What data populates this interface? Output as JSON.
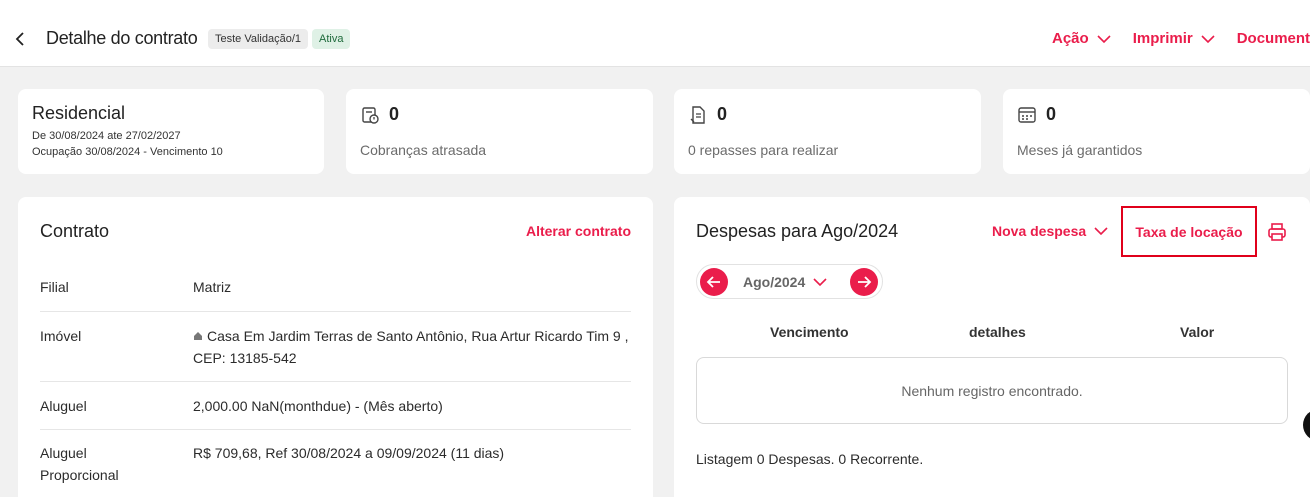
{
  "header": {
    "title": "Detalhe do contrato",
    "tag_ref": "Teste Validação/1",
    "tag_status": "Ativa",
    "actions": [
      "Ação",
      "Imprimir",
      "Documentos"
    ]
  },
  "summary": {
    "type": "Residencial",
    "period": "De 30/08/2024 ate 27/02/2027",
    "occupation": "Ocupação 30/08/2024 - Vencimento 10"
  },
  "stats": [
    {
      "value": "0",
      "label": "Cobranças atrasada",
      "icon": "overdue-invoice-icon"
    },
    {
      "value": "0",
      "label": "0 repasses para realizar",
      "icon": "transfer-document-icon"
    },
    {
      "value": "0",
      "label": "Meses já garantidos",
      "icon": "calendar-icon"
    }
  ],
  "contract": {
    "title": "Contrato",
    "edit_label": "Alterar contrato",
    "rows": [
      {
        "key": "Filial",
        "value": "Matriz"
      },
      {
        "key": "Imóvel",
        "value": "Casa Em Jardim Terras de Santo Antônio, Rua Artur Ricardo Tim 9 , CEP: 13185-542"
      },
      {
        "key": "Aluguel",
        "value": "2,000.00 NaN(monthdue) - (Mês aberto)"
      },
      {
        "key": "Aluguel Proporcional",
        "value": "R$ 709,68, Ref 30/08/2024 a 09/09/2024 (11 dias)"
      }
    ]
  },
  "expenses": {
    "title": "Despesas para Ago/2024",
    "new_label": "Nova despesa",
    "fee_label": "Taxa de locação",
    "month": "Ago/2024",
    "columns": [
      "Vencimento",
      "detalhes",
      "Valor"
    ],
    "empty_text": "Nenhum registro encontrado.",
    "listing": "Listagem 0 Despesas. 0 Recorrente."
  },
  "colors": {
    "accent": "#ea1d4b",
    "highlight": "#e0001b"
  }
}
